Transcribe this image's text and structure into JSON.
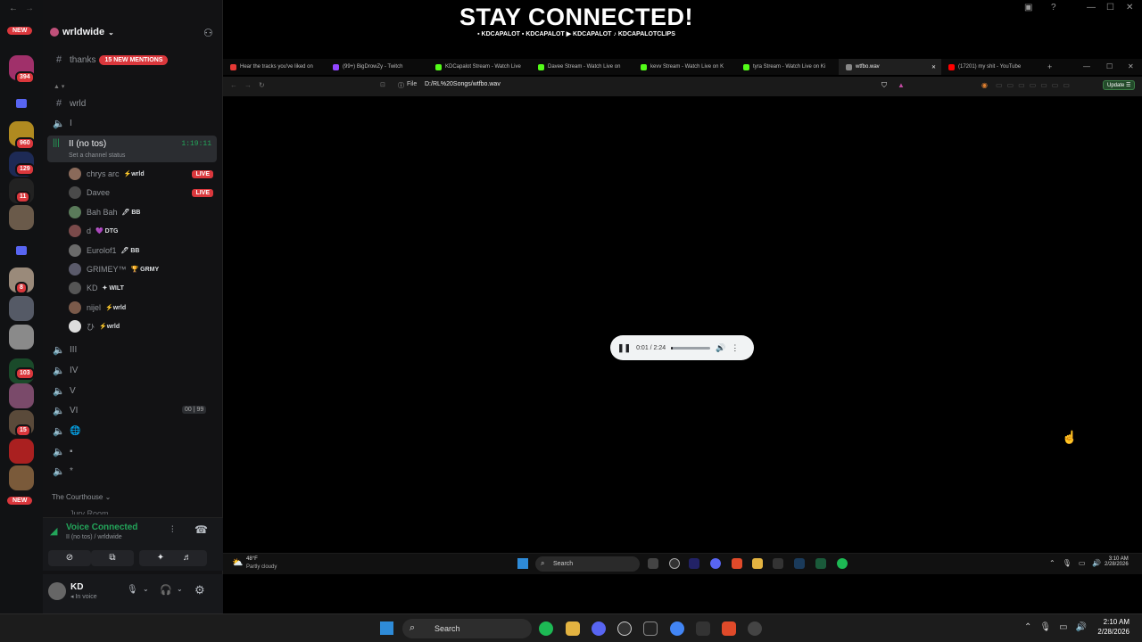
{
  "overlay": {
    "title": "STAY CONNECTED!",
    "handles": "▪ KDCAPALOT ▪ KDCAPALOT ▶ KDCAPALOT ♪ KDCAPALOTCLIPS"
  },
  "rail": {
    "badges": [
      "394",
      "960",
      "129",
      "11",
      "8",
      "103",
      "15"
    ],
    "new_top": "NEW",
    "new_bottom": "NEW"
  },
  "server": {
    "name": "wrldwide",
    "thanks_channel": "thanks",
    "mentions_pill": "15 NEW MENTIONS",
    "channels": [
      {
        "icon": "#",
        "label": "wrld"
      },
      {
        "icon": "🔊",
        "label": "I"
      }
    ],
    "active_channel": {
      "label": "II (no tos)",
      "timer": "1:19:11",
      "status": "Set a channel status"
    },
    "voice_users": [
      {
        "name": "chrys arc",
        "tag": "⚡wrld",
        "live": "LIVE",
        "color": "#8a6a5a"
      },
      {
        "name": "Davee",
        "tag": "",
        "live": "LIVE",
        "color": "#4a4a4a"
      },
      {
        "name": "Bah Bah",
        "tag": "🖊 BB",
        "live": "",
        "color": "#5a7a5a"
      },
      {
        "name": "d",
        "tag": "💜 DTG",
        "live": "",
        "color": "#7a4a4a"
      },
      {
        "name": "Eurolof1",
        "tag": "🖊 BB",
        "live": "",
        "color": "#6a6a6a"
      },
      {
        "name": "GRIMEY™",
        "tag": "🏆 GRMY",
        "live": "",
        "color": "#5a5a6a"
      },
      {
        "name": "KD",
        "tag": "✦ WILT",
        "live": "",
        "color": "#555"
      },
      {
        "name": "nijel",
        "tag": "⚡wrld",
        "live": "",
        "color": "#7a5a4a"
      },
      {
        "name": "ひ",
        "tag": "⚡wrld",
        "live": "",
        "color": "#ddd"
      }
    ],
    "more_channels": [
      "III",
      "IV",
      "V",
      "VI",
      "🌐",
      "▪",
      "*"
    ],
    "vi_counts": [
      "00",
      "99"
    ],
    "category": "The Courthouse",
    "partial_channel": "Jury Room"
  },
  "voice_panel": {
    "title": "Voice Connected",
    "subtitle": "II (no tos) / wrldwide"
  },
  "user_panel": {
    "name": "KD",
    "status": "In voice"
  },
  "browser": {
    "tabs": [
      {
        "label": "Hear the tracks you've liked on",
        "color": "#e53935",
        "active": false
      },
      {
        "label": "(99+) BigDrowZy - Twitch",
        "color": "#9146ff",
        "active": false
      },
      {
        "label": "KDCapalot Stream - Watch Live",
        "color": "#53fc18",
        "active": false
      },
      {
        "label": "Davee Stream - Watch Live on",
        "color": "#53fc18",
        "active": false
      },
      {
        "label": "kevv Stream - Watch Live on K",
        "color": "#53fc18",
        "active": false
      },
      {
        "label": "tyra Stream - Watch Live on Ki",
        "color": "#53fc18",
        "active": false
      },
      {
        "label": "wtfbo.wav",
        "color": "#888",
        "active": true
      },
      {
        "label": "(17201) my shit - YouTube",
        "color": "#ff0000",
        "active": false
      }
    ],
    "url_scheme": "File",
    "url": "D:/RL%20Songs/wtfbo.wav",
    "update": "Update"
  },
  "player": {
    "time": "0:01 / 2:24",
    "progress": 0.007
  },
  "inner_taskbar": {
    "weather_temp": "48°F",
    "weather_desc": "Partly cloudy",
    "search": "Search",
    "time": "3:10 AM",
    "date": "2/28/2026"
  },
  "taskbar": {
    "search": "Search",
    "time": "2:10 AM",
    "date": "2/28/2026"
  }
}
